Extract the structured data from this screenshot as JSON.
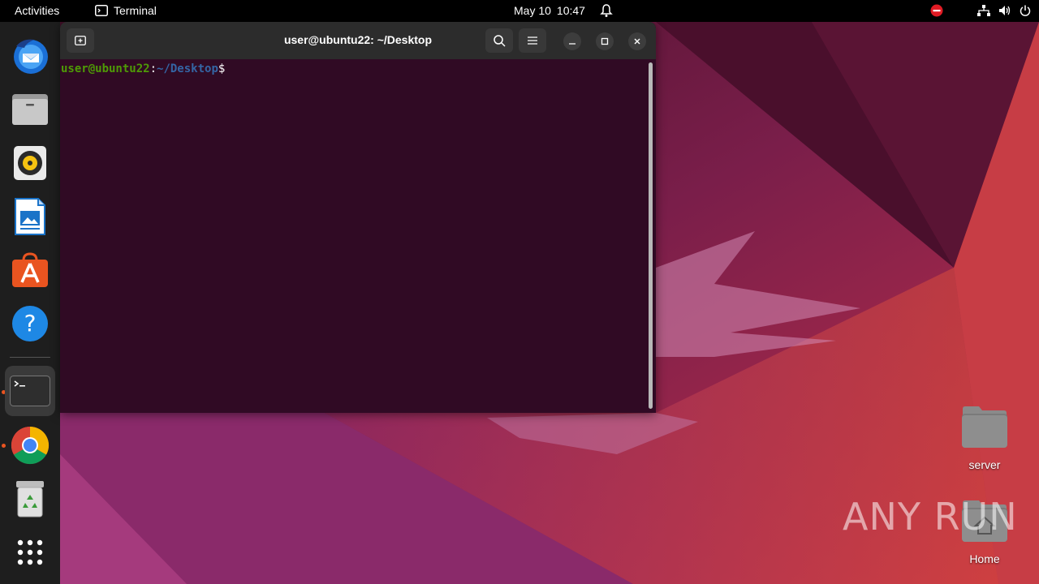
{
  "topbar": {
    "activities": "Activities",
    "app_name": "Terminal",
    "date": "May 10",
    "time": "10:47"
  },
  "dock": {
    "items": [
      {
        "name": "Thunderbird Mail",
        "icon": "thunderbird-icon"
      },
      {
        "name": "Files",
        "icon": "files-icon"
      },
      {
        "name": "Rhythmbox",
        "icon": "rhythmbox-icon"
      },
      {
        "name": "LibreOffice Writer",
        "icon": "writer-icon"
      },
      {
        "name": "Ubuntu Software",
        "icon": "software-icon"
      },
      {
        "name": "Help",
        "icon": "help-icon"
      },
      {
        "name": "Terminal",
        "icon": "terminal-icon",
        "running": true,
        "active": true
      },
      {
        "name": "Google Chrome",
        "icon": "chrome-icon",
        "running": true
      },
      {
        "name": "Trash",
        "icon": "trash-icon"
      },
      {
        "name": "Show Applications",
        "icon": "app-grid-icon"
      }
    ]
  },
  "terminal": {
    "title": "user@ubuntu22: ~/Desktop",
    "prompt_user": "user@ubuntu22",
    "prompt_sep": ":",
    "prompt_path": "~/Desktop",
    "prompt_symbol": "$"
  },
  "desktop": {
    "icons": [
      {
        "label": "server",
        "icon": "folder-icon"
      },
      {
        "label": "Home",
        "icon": "home-folder-icon"
      }
    ]
  },
  "watermark": "ANY RUN",
  "colors": {
    "accent": "#e95420",
    "terminal_bg": "#300a24",
    "prompt_user": "#4e9a06",
    "prompt_path": "#3465a4"
  }
}
